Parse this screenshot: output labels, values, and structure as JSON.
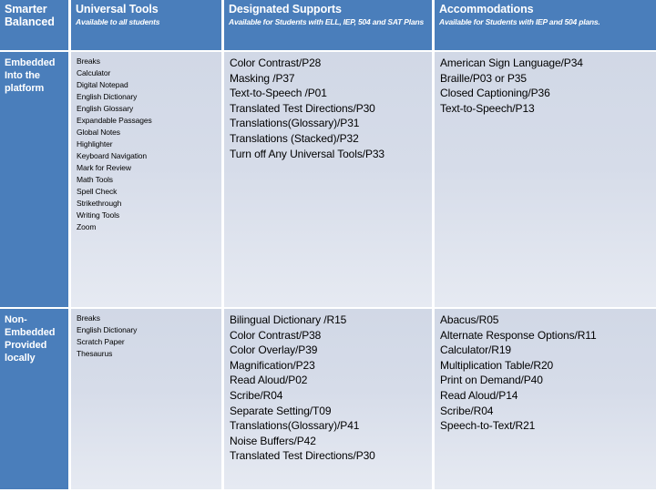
{
  "table": {
    "header": {
      "columns": [
        {
          "title": "Smarter\nBalanced",
          "subtitle": ""
        },
        {
          "title": "Universal Tools",
          "subtitle": "Available to all students"
        },
        {
          "title": "Designated Supports",
          "subtitle": "Available for Students with ELL, IEP, 504 and SAT Plans"
        },
        {
          "title": "Accommodations",
          "subtitle": "Available for Students with IEP and 504 plans."
        }
      ]
    },
    "rows": [
      {
        "label": "Embedded\nInto the\nplatform",
        "universal_tools": [
          "Breaks",
          "Calculator",
          "Digital Notepad",
          "English Dictionary",
          "English Glossary",
          "Expandable Passages",
          "Global Notes",
          "Highlighter",
          "Keyboard Navigation",
          "Mark for Review",
          "Math Tools",
          "Spell Check",
          "Strikethrough",
          "Writing Tools",
          "Zoom"
        ],
        "designated_supports": [
          "Color Contrast/P28",
          "Masking /P37",
          "Text-to-Speech /P01",
          "Translated Test Directions/P30",
          "Translations(Glossary)/P31",
          "Translations (Stacked)/P32",
          "Turn off Any Universal Tools/P33"
        ],
        "accommodations": [
          "American Sign Language/P34",
          "Braille/P03 or P35",
          "Closed Captioning/P36",
          "Text-to-Speech/P13"
        ]
      },
      {
        "label": "Non-\nEmbedded\nProvided\nlocally",
        "universal_tools": [
          "Breaks",
          "English Dictionary",
          "Scratch Paper",
          "Thesaurus"
        ],
        "designated_supports": [
          "Bilingual Dictionary /R15",
          "Color Contrast/P38",
          "Color Overlay/P39",
          "Magnification/P23",
          "Read Aloud/P02",
          "Scribe/R04",
          "Separate Setting/T09",
          "Translations(Glossary)/P41",
          "Noise Buffers/P42",
          "Translated Test Directions/P30"
        ],
        "accommodations": [
          "Abacus/R05",
          "Alternate Response Options/R11",
          "Calculator/R19",
          "Multiplication Table/R20",
          "Print on Demand/P40",
          "Read Aloud/P14",
          "Scribe/R04",
          "Speech-to-Text/R21"
        ]
      }
    ],
    "colors": {
      "header_background": "#4a7ebb",
      "header_text": "#ffffff",
      "cell_background": "#d5dbe8",
      "cell_text": "#000000",
      "gridline": "#ffffff"
    }
  }
}
